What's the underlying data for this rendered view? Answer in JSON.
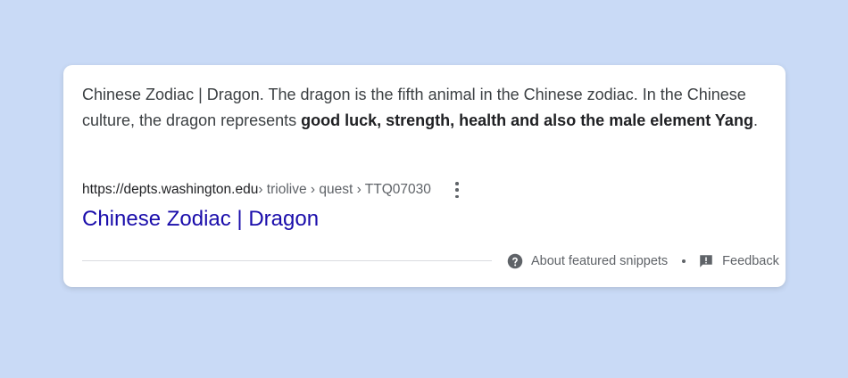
{
  "snippet": {
    "text_plain": "Chinese Zodiac | Dragon. The dragon is the fifth animal in the Chinese zodiac. In the Chinese culture, the dragon represents ",
    "text_bold": "good luck, strength, health and also the male element Yang",
    "text_end": "."
  },
  "result": {
    "url_host": "https://depts.washington.edu",
    "url_path": " › triolive › quest › TTQ07030",
    "title": "Chinese Zodiac | Dragon",
    "more_icon": "more-vert-icon"
  },
  "footer": {
    "about_label": "About featured snippets",
    "about_icon": "help-circle-icon",
    "feedback_label": "Feedback",
    "feedback_icon": "feedback-icon"
  },
  "colors": {
    "background": "#c9daf6",
    "card": "#ffffff",
    "link": "#1a0dab",
    "text": "#3c4043",
    "muted": "#5f6368"
  }
}
